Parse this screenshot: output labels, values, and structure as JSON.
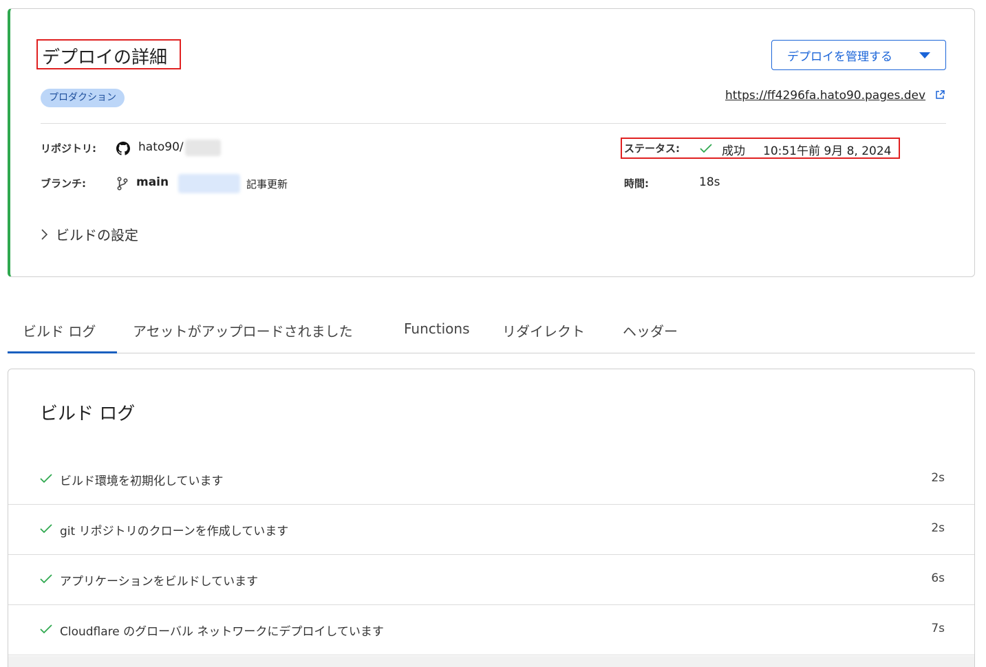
{
  "deploy": {
    "title": "デプロイの詳細",
    "manage_button_label": "デプロイを管理する",
    "environment_badge": "プロダクション",
    "url": "https://ff4296fa.hato90.pages.dev",
    "repository_label": "リポジトリ:",
    "repository_value": "hato90/",
    "branch_label": "ブランチ:",
    "branch_value": "main",
    "commit_message": "記事更新",
    "status_label": "ステータス:",
    "status_value": "成功",
    "status_time": "10:51午前 9月 8, 2024",
    "duration_label": "時間:",
    "duration_value": "18s",
    "build_settings_label": "ビルドの設定"
  },
  "tabs": [
    {
      "label": "ビルド ログ",
      "active": true
    },
    {
      "label": "アセットがアップロードされました",
      "active": false
    },
    {
      "label": "Functions",
      "active": false
    },
    {
      "label": "リダイレクト",
      "active": false
    },
    {
      "label": "ヘッダー",
      "active": false
    }
  ],
  "build_log": {
    "title": "ビルド ログ",
    "steps": [
      {
        "text": "ビルド環境を初期化しています",
        "duration": "2s"
      },
      {
        "text": "git リポジトリのクローンを作成しています",
        "duration": "2s"
      },
      {
        "text": "アプリケーションをビルドしています",
        "duration": "6s"
      },
      {
        "text": "Cloudflare のグローバル ネットワークにデプロイしています",
        "duration": "7s"
      }
    ]
  },
  "colors": {
    "accent": "#1a64d8",
    "success": "#2fa84f",
    "highlight": "#e02020"
  },
  "icons": {
    "repository": "github-icon",
    "branch": "git-branch-icon",
    "status": "check-icon",
    "url": "external-link-icon",
    "manage": "caret-down-icon",
    "build_settings": "chevron-right-icon"
  }
}
